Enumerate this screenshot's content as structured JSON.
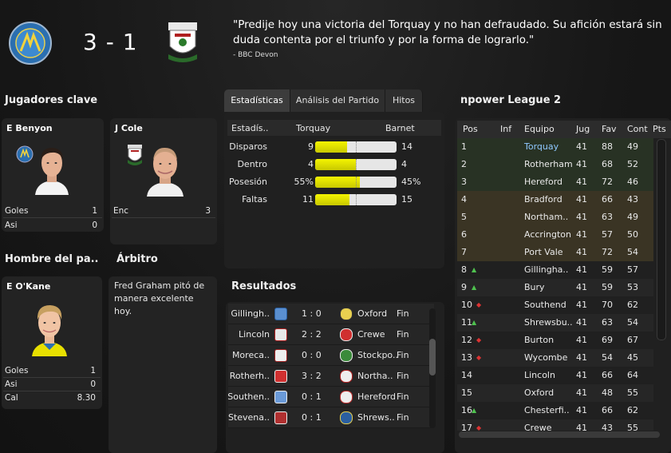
{
  "header": {
    "score": "3 - 1",
    "quote": "\"Predije hoy una victoria del Torquay y no han defraudado. Su afición estará sin duda contenta por el triunfo y por la forma de lograrlo.\"",
    "quote_source": "- BBC Devon"
  },
  "key_players": {
    "title": "Jugadores clave",
    "players": [
      {
        "name": "E Benyon",
        "stats": [
          {
            "k": "Goles",
            "v": "1"
          },
          {
            "k": "Asi",
            "v": "0"
          }
        ]
      },
      {
        "name": "J Cole",
        "stats": [
          {
            "k": "Enc",
            "v": "3"
          }
        ]
      }
    ]
  },
  "man_of_match": {
    "title": "Hombre del pa..",
    "name": "E O'Kane",
    "stats": [
      {
        "k": "Goles",
        "v": "1"
      },
      {
        "k": "Asi",
        "v": "0"
      },
      {
        "k": "Cal",
        "v": "8.30"
      }
    ]
  },
  "referee": {
    "title": "Árbitro",
    "text": "Fred Graham pitó de manera excelente hoy."
  },
  "tabs": [
    "Estadísticas",
    "Análisis del Partido",
    "Hitos"
  ],
  "stats": {
    "header": {
      "label": "Estadís..",
      "home": "Torquay",
      "away": "Barnet"
    },
    "rows": [
      {
        "label": "Disparos",
        "home": "9",
        "away": "14",
        "home_share": 0.39
      },
      {
        "label": "Dentro",
        "home": "4",
        "away": "4",
        "home_share": 0.5
      },
      {
        "label": "Posesión",
        "home": "55%",
        "away": "45%",
        "home_share": 0.55
      },
      {
        "label": "Faltas",
        "home": "11",
        "away": "15",
        "home_share": 0.42
      }
    ]
  },
  "results": {
    "title": "Resultados",
    "rows": [
      {
        "home": "Gillingh..",
        "score": "1 : 0",
        "away": "Oxford",
        "status": "Fin"
      },
      {
        "home": "Lincoln",
        "score": "2 : 2",
        "away": "Crewe",
        "status": "Fin"
      },
      {
        "home": "Moreca..",
        "score": "0 : 0",
        "away": "Stockpo..",
        "status": "Fin"
      },
      {
        "home": "Rotherh..",
        "score": "3 : 2",
        "away": "Northa..",
        "status": "Fin"
      },
      {
        "home": "Southen..",
        "score": "0 : 1",
        "away": "Hereford",
        "status": "Fin"
      },
      {
        "home": "Stevena..",
        "score": "0 : 1",
        "away": "Shrews..",
        "status": "Fin"
      }
    ]
  },
  "league": {
    "title": "npower League 2",
    "columns": [
      "Pos",
      "Inf",
      "Equipo",
      "Jug",
      "Fav",
      "Cont",
      "Pts"
    ],
    "rows": [
      {
        "pos": "1",
        "inf": "",
        "team": "Torquay",
        "jug": "41",
        "fav": "88",
        "cont": "49"
      },
      {
        "pos": "2",
        "inf": "",
        "team": "Rotherham",
        "jug": "41",
        "fav": "68",
        "cont": "52"
      },
      {
        "pos": "3",
        "inf": "",
        "team": "Hereford",
        "jug": "41",
        "fav": "72",
        "cont": "46"
      },
      {
        "pos": "4",
        "inf": "",
        "team": "Bradford",
        "jug": "41",
        "fav": "66",
        "cont": "43"
      },
      {
        "pos": "5",
        "inf": "",
        "team": "Northam..",
        "jug": "41",
        "fav": "63",
        "cont": "49"
      },
      {
        "pos": "6",
        "inf": "",
        "team": "Accrington",
        "jug": "41",
        "fav": "57",
        "cont": "50"
      },
      {
        "pos": "7",
        "inf": "",
        "team": "Port Vale",
        "jug": "41",
        "fav": "72",
        "cont": "54"
      },
      {
        "pos": "8",
        "inf": "up",
        "team": "Gillingha..",
        "jug": "41",
        "fav": "59",
        "cont": "57"
      },
      {
        "pos": "9",
        "inf": "up",
        "team": "Bury",
        "jug": "41",
        "fav": "59",
        "cont": "53"
      },
      {
        "pos": "10",
        "inf": "down",
        "team": "Southend",
        "jug": "41",
        "fav": "70",
        "cont": "62"
      },
      {
        "pos": "11",
        "inf": "up",
        "team": "Shrewsbu..",
        "jug": "41",
        "fav": "63",
        "cont": "54"
      },
      {
        "pos": "12",
        "inf": "down",
        "team": "Burton",
        "jug": "41",
        "fav": "69",
        "cont": "67"
      },
      {
        "pos": "13",
        "inf": "down",
        "team": "Wycombe",
        "jug": "41",
        "fav": "54",
        "cont": "45"
      },
      {
        "pos": "14",
        "inf": "",
        "team": "Lincoln",
        "jug": "41",
        "fav": "66",
        "cont": "64"
      },
      {
        "pos": "15",
        "inf": "",
        "team": "Oxford",
        "jug": "41",
        "fav": "48",
        "cont": "55"
      },
      {
        "pos": "16",
        "inf": "up",
        "team": "Chesterfi..",
        "jug": "41",
        "fav": "66",
        "cont": "62"
      },
      {
        "pos": "17",
        "inf": "down",
        "team": "Crewe",
        "jug": "41",
        "fav": "43",
        "cont": "55"
      }
    ]
  },
  "colors": {
    "accent_yellow": "#e8e800",
    "promotion_row": "#283224",
    "playoff_row": "#3a3424",
    "highlight_team": "#8fc8ff"
  }
}
